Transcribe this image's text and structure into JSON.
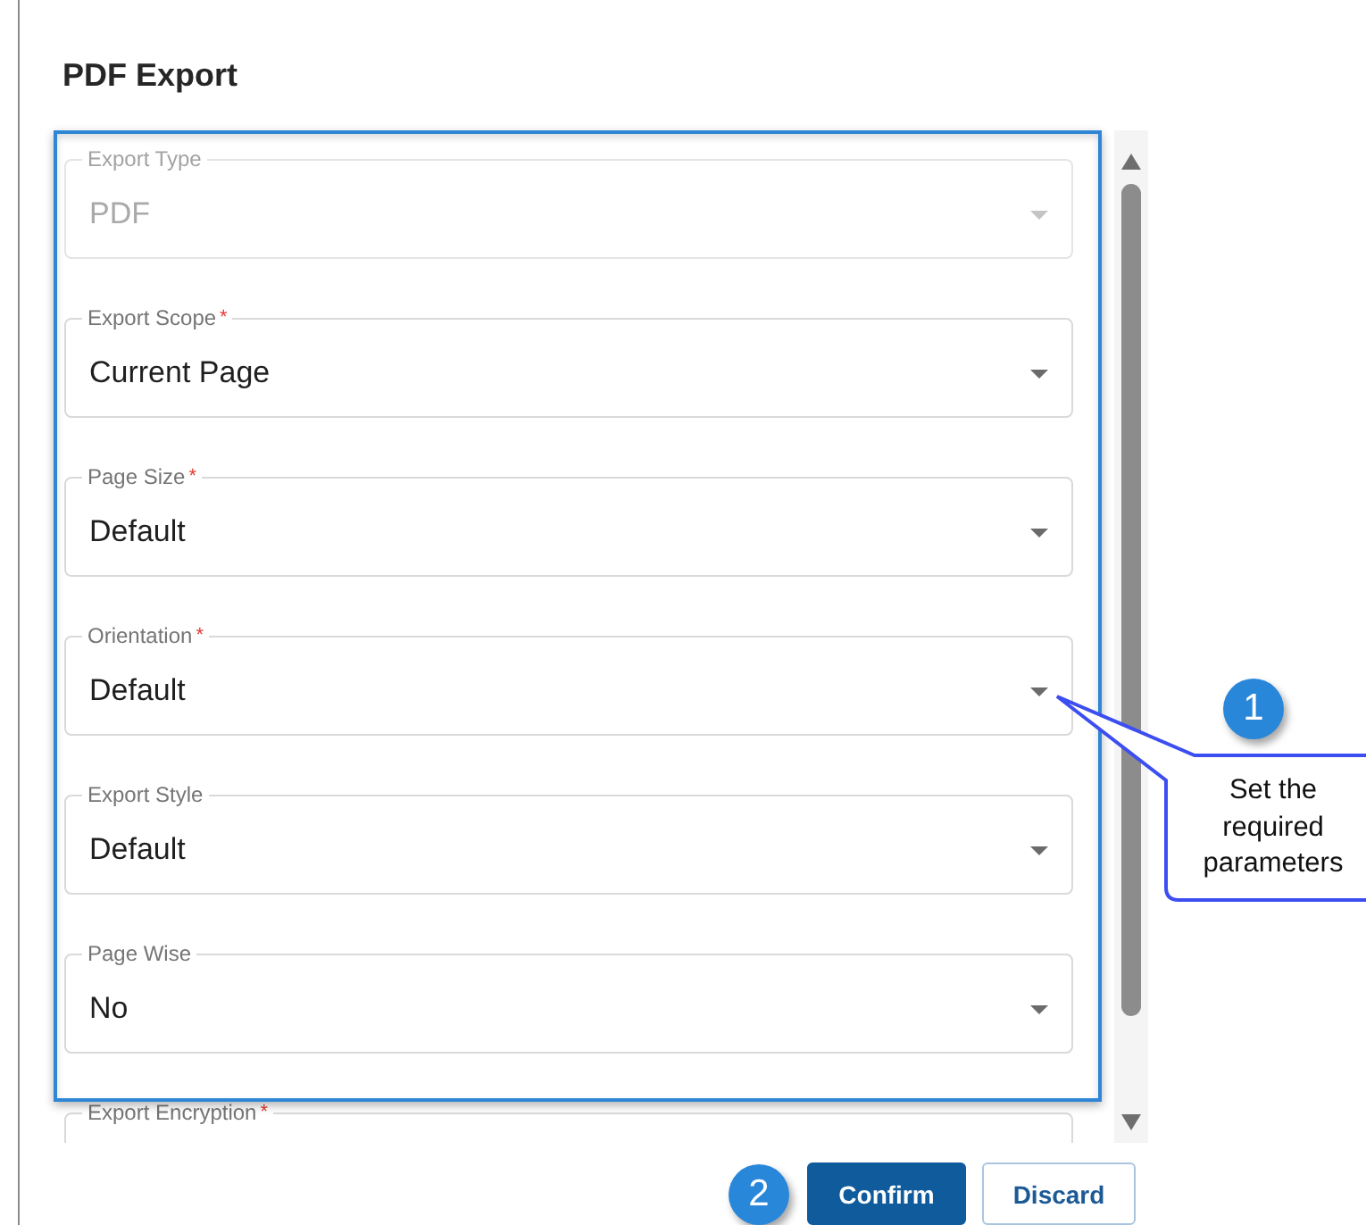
{
  "title": "PDF Export",
  "fields": [
    {
      "label": "Export Type",
      "value": "PDF",
      "disabled": true
    },
    {
      "label": "Export Scope",
      "required_mark": "*",
      "value": "Current Page",
      "disabled": false
    },
    {
      "label": "Page Size",
      "required_mark": "*",
      "value": "Default",
      "disabled": false
    },
    {
      "label": "Orientation",
      "required_mark": "*",
      "value": "Default",
      "disabled": false
    },
    {
      "label": "Export Style",
      "value": "Default",
      "disabled": false
    },
    {
      "label": "Page Wise",
      "value": "No",
      "disabled": false
    },
    {
      "label": "Export Encryption",
      "required_mark": "*",
      "disabled": false
    }
  ],
  "buttons": [
    {
      "label": "Confirm",
      "kind": "primary"
    },
    {
      "label": "Discard",
      "kind": "secondary"
    }
  ],
  "annotations": [
    {
      "number": "1",
      "text": "Set the required parameters"
    },
    {
      "number": "2"
    }
  ]
}
